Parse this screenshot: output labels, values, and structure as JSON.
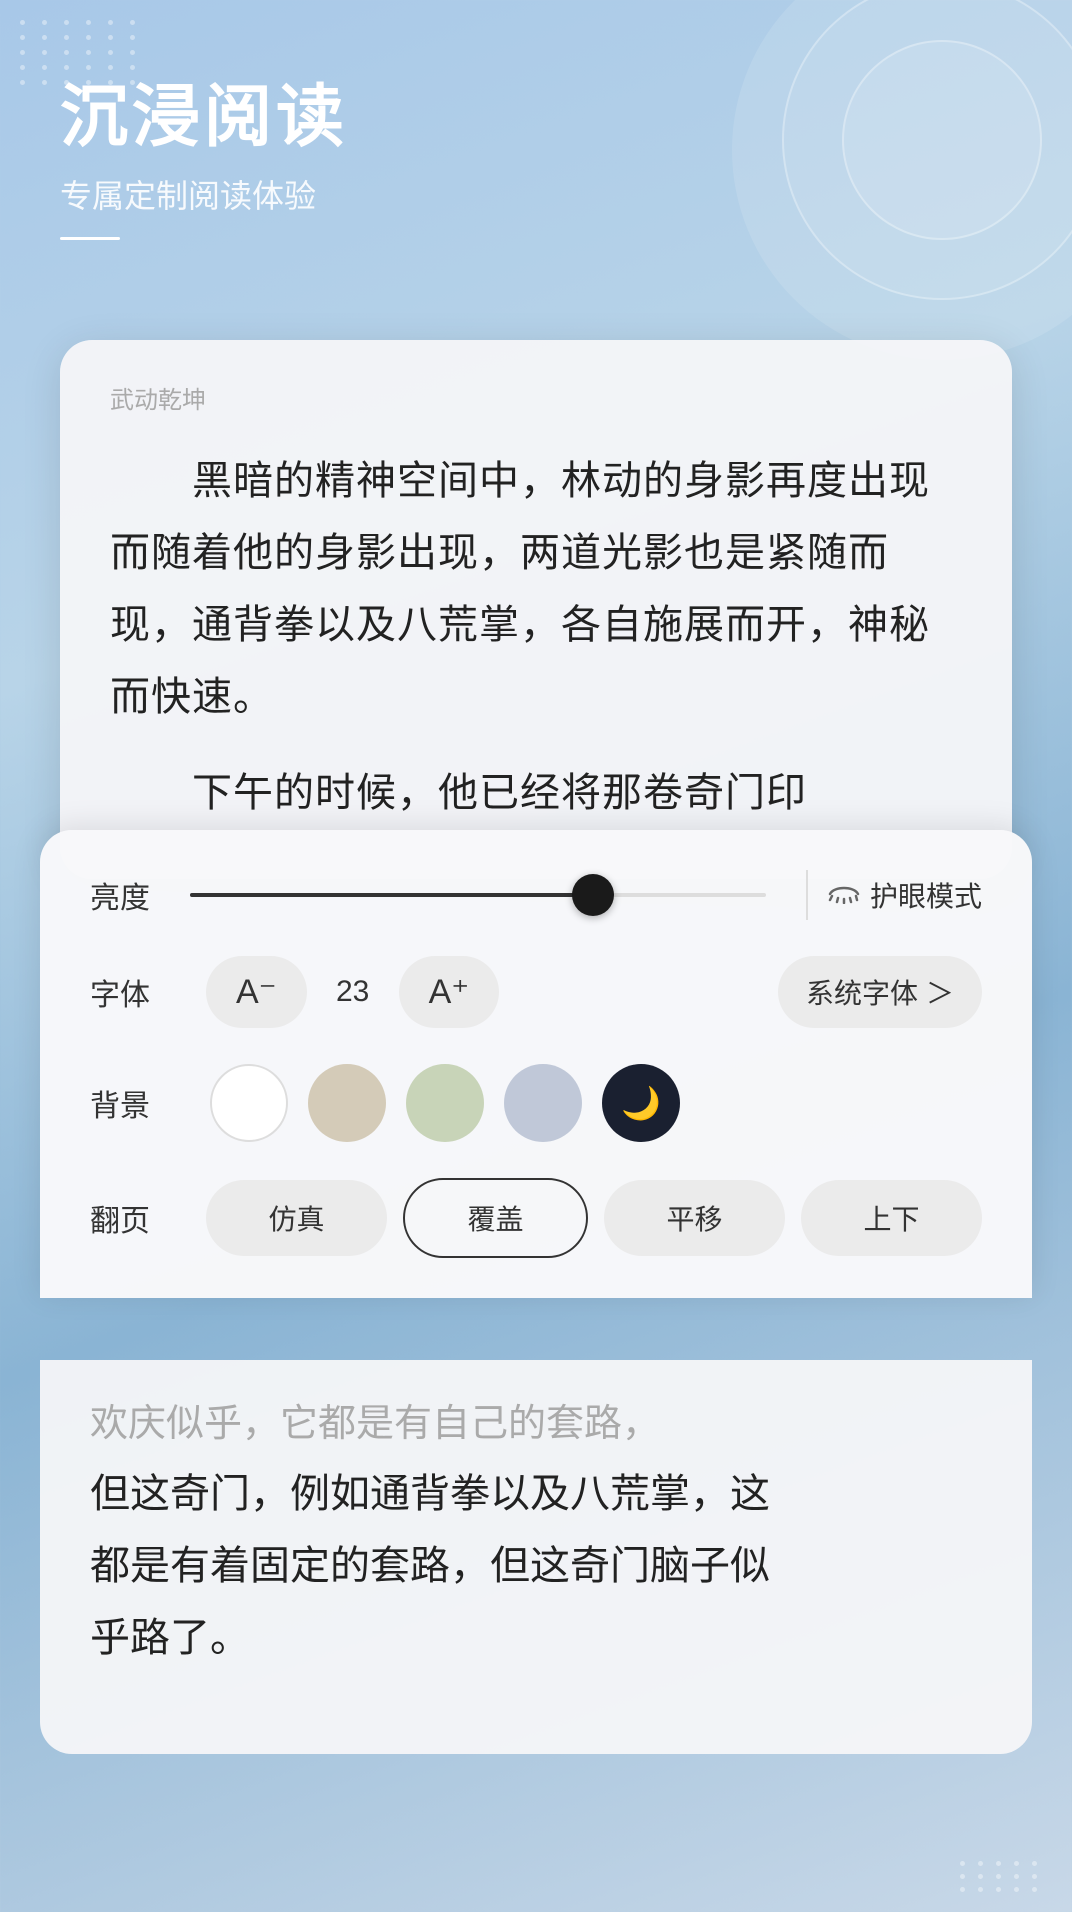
{
  "header": {
    "title": "沉浸阅读",
    "subtitle": "专属定制阅读体验"
  },
  "book": {
    "title": "武动乾坤",
    "paragraph1": "　　黑暗的精神空间中，林动的身影再度出现而随着他的身影出现，两道光影也是紧随而现，通背拳以及八荒掌，各自施展而开，神秘而快速。",
    "paragraph2": "　　下午的时候，他已经将那卷奇门印",
    "paragraph3_partial": "欢庆似乎，它都是有自己的套路，",
    "bottom_text1": "但这奇门，例如通背拳以及八荒掌，这",
    "bottom_text2": "都是有着固定的套路，但这奇门脑子似",
    "bottom_text3": "乎路了。"
  },
  "settings": {
    "brightness_label": "亮度",
    "brightness_value": 70,
    "eye_mode_label": "护眼模式",
    "font_label": "字体",
    "font_decrease": "A⁻",
    "font_size": "23",
    "font_increase": "A⁺",
    "font_family": "系统字体",
    "font_family_arrow": "＞",
    "background_label": "背景",
    "page_label": "翻页",
    "page_options": [
      "仿真",
      "覆盖",
      "平移",
      "上下"
    ],
    "page_active": "覆盖"
  }
}
